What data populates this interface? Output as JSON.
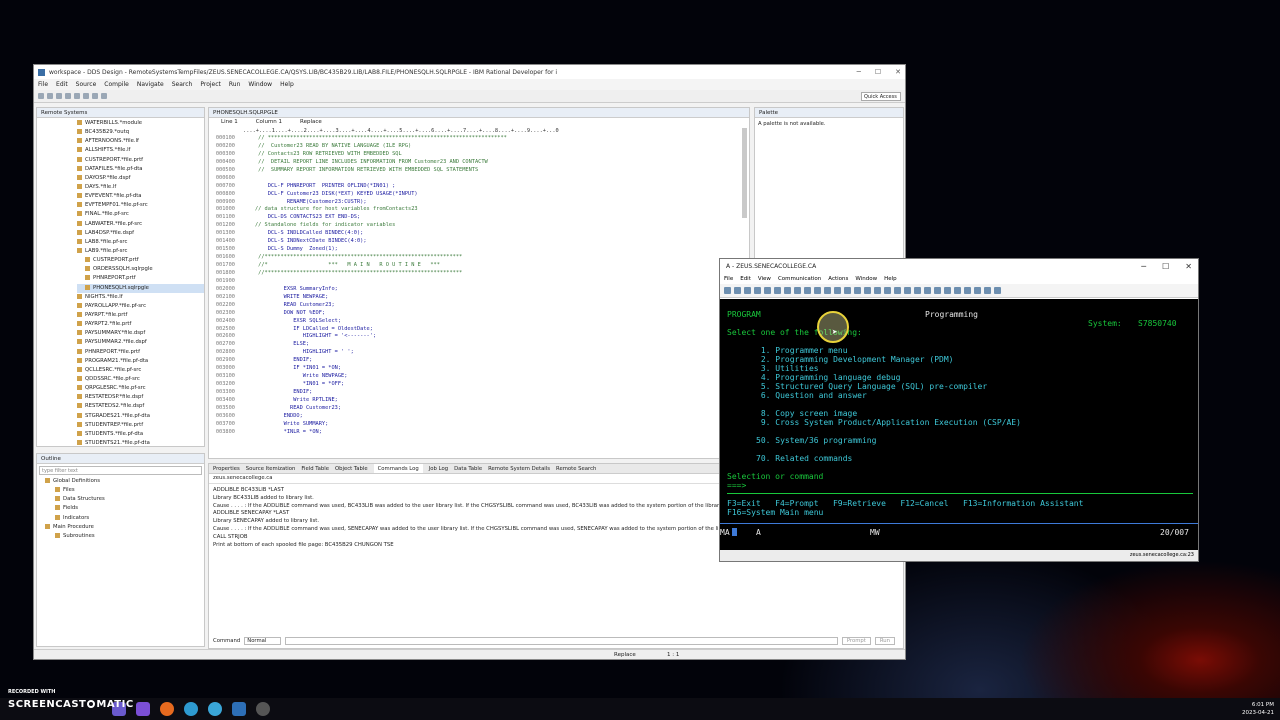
{
  "ide": {
    "title": "workspace - DDS Design - RemoteSystemsTempFiles/ZEUS.SENECACOLLEGE.CA/QSYS.LIB/BC435B29.LIB/LAB8.FILE/PHONESQLH.SQLRPGLE - IBM Rational Developer for i",
    "menu": [
      "File",
      "Edit",
      "Source",
      "Compile",
      "Navigate",
      "Search",
      "Project",
      "Run",
      "Window",
      "Help"
    ],
    "quick_access": "Quick Access",
    "remote_systems_tab": "Remote Systems",
    "tree": [
      "WATERBILLS.*module",
      "BC435B29.*outq",
      "AFTERNOONS.*file.lf",
      "ALLSHIFTS.*file.lf",
      "CUSTREPORT.*file.prtf",
      "DATAFILES.*file.pf-dta",
      "DAYOSP.*file.dspf",
      "DAYS.*file.lf",
      "EVFEVENT.*file.pf-dta",
      "EVFTEMPF01.*file.pf-src",
      "FINAL.*file.pf-src",
      "LABWATER.*file.pf-src",
      "LAB4DSP.*file.dspf",
      "LAB8.*file.pf-src",
      "LAB9.*file.pf-src",
      "CUSTREPORT.prtf",
      "ORDERSSQLH.sqlrpgle",
      "PHNREPORT.prtf",
      "PHONESQLH.sqlrpgle",
      "NIGHTS.*file.lf",
      "PAYROLLAPP.*file.pf-src",
      "PAYRPT.*file.prtf",
      "PAYRPT2.*file.prtf",
      "PAYSUMMARY.*file.dspf",
      "PAYSUMMAR2.*file.dspf",
      "PHNREPORT.*file.prtf",
      "PROGRAM21.*file.pf-dta",
      "QCLLESRC.*file.pf-src",
      "QDDSSRC.*file.pf-src",
      "QRPGLESRC.*file.pf-src",
      "RESTATEDSP.*file.dspf",
      "RESTATEDS2.*file.dspf",
      "STGRADES21.*file.pf-dta",
      "STUDENTREP.*file.prtf",
      "STUDENTS.*file.pf-dta",
      "STUDENTS21.*file.pf-dta"
    ],
    "outline_tab": "Outline",
    "outline_filter": "type filter text",
    "outline": [
      "Global Definitions",
      "Files",
      "Data Structures",
      "Fields",
      "Indicators",
      "Main Procedure",
      "Subroutines"
    ],
    "editor_tab": "PHONESQLH.SQLRPGLE",
    "editor_status": [
      "Line 1",
      "Column 1",
      "Replace"
    ],
    "ruler": "....+....1....+....2....+....3....+....4....+....5....+....6....+....7....+....8....+....9....+...0",
    "code": [
      {
        "n": "000100",
        "t": "      // ***************************************************************************",
        "c": true
      },
      {
        "n": "000200",
        "t": "      //  Customer23 READ BY NATIVE LANGUAGE (ILE RPG)",
        "c": true
      },
      {
        "n": "000300",
        "t": "      // Contacts23 ROW RETRIEVED WITH EMBEDDED SQL",
        "c": true
      },
      {
        "n": "000400",
        "t": "      //  DETAIL REPORT LINE INCLUDES INFORMATION FROM Customer23 AND CONTACTW",
        "c": true
      },
      {
        "n": "000500",
        "t": "      //  SUMMARY REPORT INFORMATION RETRIEVED WITH EMBEDDED SQL STATEMENTS",
        "c": true
      },
      {
        "n": "000600",
        "t": "",
        "c": false
      },
      {
        "n": "000700",
        "t": "         DCL-F PHNREPORT  PRINTER OFLIND(*IN01) ;",
        "c": false
      },
      {
        "n": "000800",
        "t": "         DCL-F Customer23 DISK(*EXT) KEYED USAGE(*INPUT)",
        "c": false
      },
      {
        "n": "000900",
        "t": "               RENAME(Customer23:CUSTR);",
        "c": false
      },
      {
        "n": "001000",
        "t": "     // data structure for host variables fromContacts23",
        "c": true
      },
      {
        "n": "001100",
        "t": "         DCL-DS CONTACTS23 EXT END-DS;",
        "c": false
      },
      {
        "n": "001200",
        "t": "     // Standalone fields for indicator variables",
        "c": true
      },
      {
        "n": "001300",
        "t": "         DCL-S INDLDCalled BINDEC(4:0);",
        "c": false
      },
      {
        "n": "001400",
        "t": "         DCL-S INDNextCDate BINDEC(4:0);",
        "c": false
      },
      {
        "n": "001500",
        "t": "         DCL-S Dummy  Zoned(1);",
        "c": false
      },
      {
        "n": "001600",
        "t": "      //**************************************************************",
        "c": true
      },
      {
        "n": "001700",
        "t": "      //*                   ***   M A I N   R O U T I N E   ***",
        "c": true
      },
      {
        "n": "001800",
        "t": "      //**************************************************************",
        "c": true
      },
      {
        "n": "001900",
        "t": "",
        "c": false
      },
      {
        "n": "002000",
        "t": "              EXSR SummaryInfo;",
        "c": false
      },
      {
        "n": "002100",
        "t": "              WRITE NEWPAGE;",
        "c": false
      },
      {
        "n": "002200",
        "t": "              READ Customer23;",
        "c": false
      },
      {
        "n": "002300",
        "t": "              DOW NOT %EOF;",
        "c": false
      },
      {
        "n": "002400",
        "t": "                 EXSR SQLSelect;",
        "c": false
      },
      {
        "n": "002500",
        "t": "                 IF LDCalled = OldestDate;",
        "c": false
      },
      {
        "n": "002600",
        "t": "                    HIGHLIGHT = '<-------';",
        "c": false
      },
      {
        "n": "002700",
        "t": "                 ELSE;",
        "c": false
      },
      {
        "n": "002800",
        "t": "                    HIGHLIGHT = ' ';",
        "c": false
      },
      {
        "n": "002900",
        "t": "                 ENDIF;",
        "c": false
      },
      {
        "n": "003000",
        "t": "                 IF *IN01 = *ON;",
        "c": false
      },
      {
        "n": "003100",
        "t": "                    Write NEWPAGE;",
        "c": false
      },
      {
        "n": "003200",
        "t": "                    *IN01 = *OFF;",
        "c": false
      },
      {
        "n": "003300",
        "t": "                 ENDIF;",
        "c": false
      },
      {
        "n": "003400",
        "t": "                 Write RPTLINE;",
        "c": false
      },
      {
        "n": "003500",
        "t": "                READ Customer23;",
        "c": false
      },
      {
        "n": "003600",
        "t": "              ENDDO;",
        "c": false
      },
      {
        "n": "003700",
        "t": "              Write SUMMARY;",
        "c": false
      },
      {
        "n": "003800",
        "t": "              *INLR = *ON;",
        "c": false
      }
    ],
    "palette_tab": "Palette",
    "palette_msg": "A palette is not available.",
    "bottom_tabs": [
      "Properties",
      "Source Itemization",
      "Field Table",
      "Object Table",
      "Commands Log",
      "Job Log",
      "Data Table",
      "Remote System Details",
      "Remote Search"
    ],
    "bottom_active": "zeus.senecacollege.ca",
    "log": [
      "ADDLIBLE BC433LIB *LAST",
      "Library BC433LIB added to library list.",
      "Cause . . . . :   If the ADDLIBLE command was used, BC433LIB was added to the user library list.  If the CHGSYSLIBL command was used, BC433LIB was added to the system portion of the library list.",
      "ADDLIBLE SENECAPAY *LAST",
      "Library SENECAPAY added to library list.",
      "Cause . . . . :   If the ADDLIBLE command was used, SENECAPAY was added to the user library list.  If the CHGSYSLIBL command was used, SENECAPAY was added to the system portion of the library list.",
      "CALL STRJOB",
      "Print at bottom of each spooled file page: BC435B29 CHUNGON TSE"
    ],
    "command_label": "Command",
    "command_mode": "Normal",
    "prompt_btn": "Prompt",
    "run_btn": "Run",
    "status_replace": "Replace",
    "status_pos": "1 : 1"
  },
  "emulator": {
    "title": "A - ZEUS.SENECACOLLEGE.CA",
    "menu": [
      "File",
      "Edit",
      "View",
      "Communication",
      "Actions",
      "Window",
      "Help"
    ],
    "screen": {
      "program": "PROGRAM",
      "heading": "Programming",
      "system_label": "System:",
      "system_value": "S7850740",
      "select": "Select one of the following:",
      "options": [
        " 1. Programmer menu",
        " 2. Programming Development Manager (PDM)",
        " 3. Utilities",
        " 4. Programming language debug",
        " 5. Structured Query Language (SQL) pre-compiler",
        " 6. Question and answer",
        " 8. Copy screen image",
        " 9. Cross System Product/Application Execution (CSP/AE)",
        "50. System/36 programming",
        "70. Related commands"
      ],
      "selection": "Selection or command",
      "prompt": "===>",
      "fkeys1": "F3=Exit   F4=Prompt   F9=Retrieve   F12=Cancel   F13=Information Assistant",
      "fkeys2": "F16=System Main menu",
      "oia_left": "MA",
      "oia_a": "A",
      "oia_mw": "MW",
      "oia_pos": "20/007"
    },
    "status_host": "zeus.senecacollege.ca:23"
  },
  "watermark": {
    "line1": "RECORDED WITH",
    "line2": "SCREENCAST",
    "line3": "MATIC"
  },
  "clock": {
    "time": "6:01 PM",
    "date": "2023-04-21"
  }
}
